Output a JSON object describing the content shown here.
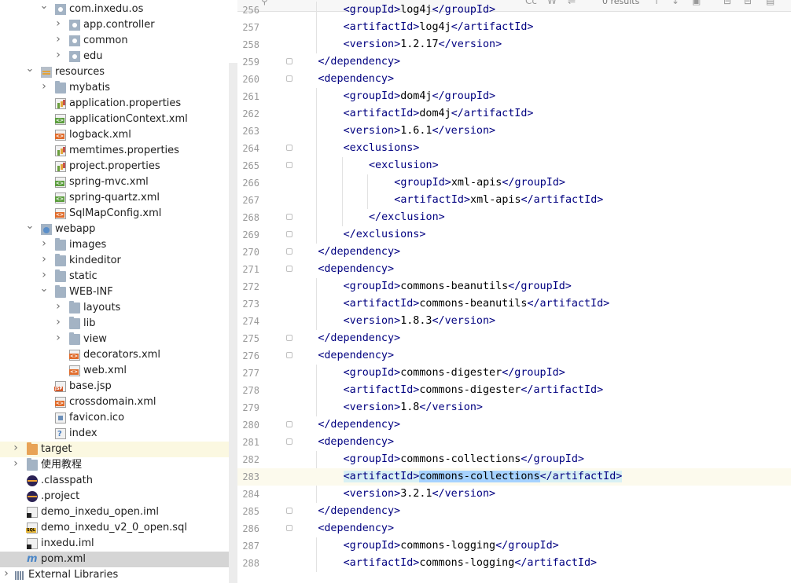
{
  "project_tree": {
    "items": [
      {
        "label": "com.inxedu.os",
        "icon": "package-folder-icon",
        "expanded": true
      },
      {
        "label": "app.controller",
        "icon": "package-folder-icon",
        "expanded": false
      },
      {
        "label": "common",
        "icon": "package-folder-icon",
        "expanded": false
      },
      {
        "label": "edu",
        "icon": "package-folder-icon",
        "expanded": false
      },
      {
        "label": "resources",
        "icon": "resources-folder-icon",
        "expanded": true
      },
      {
        "label": "mybatis",
        "icon": "folder-icon",
        "expanded": false
      },
      {
        "label": "application.properties",
        "icon": "properties-file-icon"
      },
      {
        "label": "applicationContext.xml",
        "icon": "spring-xml-file-icon"
      },
      {
        "label": "logback.xml",
        "icon": "xml-file-icon"
      },
      {
        "label": "memtimes.properties",
        "icon": "properties-file-icon"
      },
      {
        "label": "project.properties",
        "icon": "properties-file-icon"
      },
      {
        "label": "spring-mvc.xml",
        "icon": "spring-xml-file-icon"
      },
      {
        "label": "spring-quartz.xml",
        "icon": "spring-xml-file-icon"
      },
      {
        "label": "SqlMapConfig.xml",
        "icon": "xml-file-icon"
      },
      {
        "label": "webapp",
        "icon": "web-folder-icon",
        "expanded": true
      },
      {
        "label": "images",
        "icon": "folder-icon",
        "expanded": false
      },
      {
        "label": "kindeditor",
        "icon": "folder-icon",
        "expanded": false
      },
      {
        "label": "static",
        "icon": "folder-icon",
        "expanded": false
      },
      {
        "label": "WEB-INF",
        "icon": "folder-icon",
        "expanded": true
      },
      {
        "label": "layouts",
        "icon": "folder-icon",
        "expanded": false
      },
      {
        "label": "lib",
        "icon": "folder-icon",
        "expanded": false
      },
      {
        "label": "view",
        "icon": "folder-icon",
        "expanded": false
      },
      {
        "label": "decorators.xml",
        "icon": "xml-file-icon"
      },
      {
        "label": "web.xml",
        "icon": "web-xml-file-icon"
      },
      {
        "label": "base.jsp",
        "icon": "jsp-file-icon"
      },
      {
        "label": "crossdomain.xml",
        "icon": "xml-file-icon"
      },
      {
        "label": "favicon.ico",
        "icon": "image-file-icon"
      },
      {
        "label": "index",
        "icon": "unknown-file-icon"
      },
      {
        "label": "target",
        "icon": "excluded-folder-icon",
        "expanded": false
      },
      {
        "label": "使用教程",
        "icon": "folder-icon",
        "expanded": false
      },
      {
        "label": ".classpath",
        "icon": "eclipse-file-icon"
      },
      {
        "label": ".project",
        "icon": "eclipse-file-icon"
      },
      {
        "label": "demo_inxedu_open.iml",
        "icon": "iml-file-icon"
      },
      {
        "label": "demo_inxedu_v2_0_open.sql",
        "icon": "sql-file-icon"
      },
      {
        "label": "inxedu.iml",
        "icon": "iml-file-icon"
      },
      {
        "label": "pom.xml",
        "icon": "maven-file-icon",
        "selected": true
      },
      {
        "label": "External Libraries",
        "icon": "libraries-icon",
        "expanded": false
      }
    ]
  },
  "search": {
    "match_case": "Cc",
    "whole_words": "W",
    "results": "0 results"
  },
  "editor": {
    "lines": [
      {
        "n": "256",
        "text": "<groupId>log4j</groupId>"
      },
      {
        "n": "257",
        "text": "<artifactId>log4j</artifactId>"
      },
      {
        "n": "258",
        "text": "<version>1.2.17</version>"
      },
      {
        "n": "259",
        "text": "</dependency>"
      },
      {
        "n": "260",
        "text": "<dependency>"
      },
      {
        "n": "261",
        "text": "<groupId>dom4j</groupId>"
      },
      {
        "n": "262",
        "text": "<artifactId>dom4j</artifactId>"
      },
      {
        "n": "263",
        "text": "<version>1.6.1</version>"
      },
      {
        "n": "264",
        "text": "<exclusions>"
      },
      {
        "n": "265",
        "text": "<exclusion>"
      },
      {
        "n": "266",
        "text": "<groupId>xml-apis</groupId>"
      },
      {
        "n": "267",
        "text": "<artifactId>xml-apis</artifactId>"
      },
      {
        "n": "268",
        "text": "</exclusion>"
      },
      {
        "n": "269",
        "text": "</exclusions>"
      },
      {
        "n": "270",
        "text": "</dependency>"
      },
      {
        "n": "271",
        "text": "<dependency>"
      },
      {
        "n": "272",
        "text": "<groupId>commons-beanutils</groupId>"
      },
      {
        "n": "273",
        "text": "<artifactId>commons-beanutils</artifactId>"
      },
      {
        "n": "274",
        "text": "<version>1.8.3</version>"
      },
      {
        "n": "275",
        "text": "</dependency>"
      },
      {
        "n": "276",
        "text": "<dependency>"
      },
      {
        "n": "277",
        "text": "<groupId>commons-digester</groupId>"
      },
      {
        "n": "278",
        "text": "<artifactId>commons-digester</artifactId>"
      },
      {
        "n": "279",
        "text": "<version>1.8</version>"
      },
      {
        "n": "280",
        "text": "</dependency>"
      },
      {
        "n": "281",
        "text": "<dependency>"
      },
      {
        "n": "282",
        "text": "<groupId>commons-collections</groupId>"
      },
      {
        "n": "283",
        "text": "<artifactId>commons-collections</artifactId>"
      },
      {
        "n": "284",
        "text": "<version>3.2.1</version>"
      },
      {
        "n": "285",
        "text": "</dependency>"
      },
      {
        "n": "286",
        "text": "<dependency>"
      },
      {
        "n": "287",
        "text": "<groupId>commons-logging</groupId>"
      },
      {
        "n": "288",
        "text": "<artifactId>commons-logging</artifactId>"
      }
    ]
  }
}
